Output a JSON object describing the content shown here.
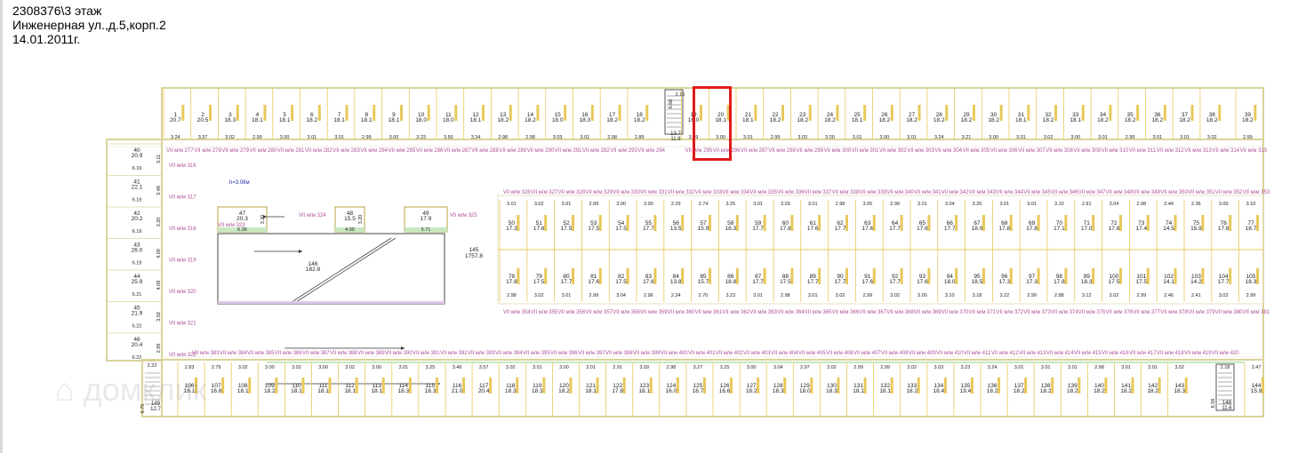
{
  "header": {
    "line1": "2308376\\3 этаж",
    "line2": "Инженерная ул.,д.5,корп.2",
    "line3": "14.01.2011г."
  },
  "colors": {
    "wall": "#d8d49a",
    "divider": "#e8c85a",
    "label_pink": "#b0509a",
    "text": "#222222",
    "highlight": "#e01a1a",
    "interior": "#9aa0c8"
  },
  "watermark": "домклик",
  "plan": {
    "height_note": "h=3.08м",
    "top_row": {
      "ids": [
        "1",
        "2",
        "3",
        "4",
        "5",
        "6",
        "7",
        "8",
        "9",
        "10",
        "11",
        "12",
        "13",
        "14",
        "15",
        "16",
        "17",
        "18",
        "19",
        "20",
        "21",
        "22",
        "23",
        "24",
        "25",
        "26",
        "27",
        "28",
        "29",
        "30",
        "31",
        "32",
        "33",
        "34",
        "35",
        "36",
        "37",
        "38",
        "39"
      ],
      "areas": [
        "20.7",
        "20.5",
        "18.3",
        "18.1",
        "18.1",
        "18.2",
        "18.1",
        "18.1",
        "18.1",
        "18.0",
        "18.0",
        "18.1",
        "18.2",
        "18.2",
        "18.0",
        "18.3",
        "18.2",
        "18.2",
        "16.0",
        "18.1",
        "18.1",
        "18.2",
        "18.2",
        "18.2",
        "18.1",
        "18.2",
        "18.2",
        "18.2",
        "18.2",
        "18.2",
        "18.1",
        "18.2",
        "18.1",
        "18.2",
        "18.2",
        "18.2",
        "18.2",
        "18.2",
        "18.2"
      ],
      "widths": [
        "3.24",
        "3.37",
        "3.02",
        "2.99",
        "3.00",
        "3.01",
        "3.01",
        "2.99",
        "3.00",
        "3.23",
        "3.50",
        "3.34",
        "2.98",
        "2.98",
        "3.03",
        "3.01",
        "2.98",
        "2.89",
        "3.29",
        "3.00",
        "3.01",
        "2.99",
        "3.03",
        "3.00",
        "3.01",
        "3.00",
        "3.01",
        "3.24",
        "3.21",
        "3.00",
        "3.01",
        "3.02",
        "3.00",
        "3.01",
        "2.99",
        "3.01",
        "3.01",
        "3.02",
        "2.99"
      ]
    },
    "corridor_top": [
      "VII м/м 277",
      "VII м/м 278",
      "VII м/м 279",
      "VII м/м 280",
      "VII м/м 281",
      "VII м/м 282",
      "VII м/м 283",
      "VII м/м 284",
      "VII м/м 285",
      "VII м/м 286",
      "VII м/м 287",
      "VII м/м 288",
      "VII м/м 289",
      "VII м/м 290",
      "VII м/м 291",
      "VII м/м 292",
      "VII м/м 293",
      "VII м/м 294",
      "VII м/м 295",
      "VII м/м 296",
      "VII м/м 297",
      "VII м/м 298",
      "VII м/м 299",
      "VII м/м 300",
      "VII м/м 301",
      "VII м/м 302",
      "VII м/м 303",
      "VII м/м 304",
      "VII м/м 305",
      "VII м/м 306",
      "VII м/м 307",
      "VII м/м 308",
      "VII м/м 309",
      "VII м/м 310",
      "VII м/м 311",
      "VII м/м 312",
      "VII м/м 313",
      "VII м/м 314",
      "VII м/м 315"
    ],
    "stair_top": {
      "dim": "2.15",
      "dim2": "6.50",
      "id": "13.7",
      "area": "11.8"
    },
    "left_block": [
      {
        "id": "40",
        "area": "20.9",
        "w": "3.11"
      },
      {
        "id": "41",
        "area": "22.1",
        "w": "3.48"
      },
      {
        "id": "42",
        "area": "20.2",
        "w": "3.20"
      },
      {
        "id": "43",
        "area": "26.0",
        "w": "4.09"
      },
      {
        "id": "44",
        "area": "25.9",
        "w": "4.09"
      },
      {
        "id": "45",
        "area": "21.9",
        "w": "3.59"
      },
      {
        "id": "46",
        "area": "20.4",
        "w": "2.99"
      }
    ],
    "left_dims": [
      "6.19",
      "6.19",
      "6.19",
      "6.19",
      "6.21",
      "6.22",
      "6.22"
    ],
    "left_labels": [
      "VII м/м 316",
      "VII м/м 317",
      "VII м/м 318",
      "VII м/м 319",
      "VII м/м 320",
      "VII м/м 321",
      "VII м/м 322"
    ],
    "hall_spots": [
      {
        "id": "47",
        "area": "20.3",
        "w": "6.36",
        "d": "3.20"
      },
      {
        "id": "48",
        "area": "15.5",
        "w": "4.90",
        "d": "3.20"
      },
      {
        "id": "49",
        "area": "17.9",
        "w": "5.71",
        "d": ""
      }
    ],
    "hall_labels": [
      "VII м/м 323",
      "VII м/м 324",
      "VII м/м 325"
    ],
    "ramp": {
      "id": "146",
      "area": "182.8"
    },
    "zone": {
      "id": "145",
      "area": "1757.8"
    },
    "mid_top_labels": [
      "VII м/м 326",
      "VII м/м 327",
      "VII м/м 328",
      "VII м/м 329",
      "VII м/м 330",
      "VII м/м 331",
      "VII м/м 332",
      "VII м/м 333",
      "VII м/м 334",
      "VII м/м 335",
      "VII м/м 336",
      "VII м/м 337",
      "VII м/м 338",
      "VII м/м 339",
      "VII м/м 340",
      "VII м/м 341",
      "VII м/м 342",
      "VII м/м 343",
      "VII м/м 344",
      "VII м/м 345",
      "VII м/м 346",
      "VII м/м 347",
      "VII м/м 348",
      "VII м/м 349",
      "VII м/м 350",
      "VII м/м 351",
      "VII м/м 352",
      "VII м/м 353"
    ],
    "mid_row_a": {
      "ids": [
        "50",
        "51",
        "52",
        "53",
        "54",
        "55",
        "56",
        "57",
        "58",
        "59",
        "60",
        "61",
        "62",
        "63",
        "64",
        "65",
        "66",
        "67",
        "68",
        "69",
        "70",
        "71",
        "72",
        "73",
        "74",
        "75",
        "76",
        "77"
      ],
      "areas": [
        "17.3",
        "17.6",
        "17.5",
        "17.5",
        "17.5",
        "17.7",
        "13.5",
        "15.9",
        "18.3",
        "17.7",
        "17.8",
        "17.6",
        "17.7",
        "17.6",
        "17.7",
        "17.6",
        "17.7",
        "18.9",
        "17.8",
        "17.8",
        "17.1",
        "17.0",
        "17.8",
        "17.4",
        "14.5",
        "15.9",
        "17.6",
        "18.7"
      ],
      "widths": [
        "3.01",
        "3.02",
        "3.01",
        "2.99",
        "3.00",
        "3.00",
        "2.29",
        "2.74",
        "3.25",
        "3.01",
        "3.03",
        "3.01",
        "2.98",
        "3.05",
        "2.99",
        "3.01",
        "3.04",
        "3.20",
        "3.01",
        "3.01",
        "3.10",
        "2.91",
        "3.04",
        "2.98",
        "2.44",
        "2.36",
        "3.00",
        "3.10"
      ]
    },
    "mid_row_b": {
      "ids": [
        "78",
        "79",
        "80",
        "81",
        "82",
        "83",
        "84",
        "85",
        "86",
        "87",
        "88",
        "89",
        "90",
        "91",
        "92",
        "93",
        "94",
        "95",
        "96",
        "97",
        "98",
        "99",
        "100",
        "101",
        "102",
        "103",
        "104",
        "105"
      ],
      "areas": [
        "17.8",
        "17.5",
        "17.7",
        "17.6",
        "17.5",
        "17.6",
        "13.8",
        "15.7",
        "18.8",
        "17.7",
        "17.5",
        "17.7",
        "17.7",
        "17.6",
        "17.7",
        "17.6",
        "18.0",
        "18.5",
        "17.3",
        "17.3",
        "17.8",
        "18.3",
        "17.5",
        "17.5",
        "14.1",
        "14.2",
        "17.7",
        "18.3"
      ],
      "widths": [
        "2.98",
        "3.02",
        "3.01",
        "2.99",
        "3.04",
        "2.96",
        "2.34",
        "2.70",
        "3.23",
        "3.01",
        "2.98",
        "3.01",
        "3.02",
        "2.99",
        "3.02",
        "3.00",
        "3.10",
        "3.18",
        "3.22",
        "2.99",
        "2.88",
        "3.12",
        "3.02",
        "2.99",
        "2.46",
        "2.41",
        "3.02",
        "2.99"
      ]
    },
    "mid_bottom_labels": [
      "VII м/м 354",
      "VII м/м 355",
      "VII м/м 356",
      "VII м/м 357",
      "VII м/м 358",
      "VII м/м 359",
      "VII м/м 360",
      "VII м/м 361",
      "VII м/м 362",
      "VII м/м 363",
      "VII м/м 364",
      "VII м/м 365",
      "VII м/м 366",
      "VII м/м 367",
      "VII м/м 368",
      "VII м/м 369",
      "VII м/м 370",
      "VII м/м 371",
      "VII м/м 372",
      "VII м/м 373",
      "VII м/м 374",
      "VII м/м 375",
      "VII м/м 376",
      "VII м/м 377",
      "VII м/м 378",
      "VII м/м 379",
      "VII м/м 380",
      "VII м/м 381"
    ],
    "corridor_bottom": [
      "VII м/м 383",
      "VII м/м 384",
      "VII м/м 385",
      "VII м/м 386",
      "VII м/м 387",
      "VII м/м 388",
      "VII м/м 389",
      "VII м/м 390",
      "VII м/м 391",
      "VII м/м 392",
      "VII м/м 393",
      "VII м/м 394",
      "VII м/м 395",
      "VII м/м 396",
      "VII м/м 397",
      "VII м/м 398",
      "VII м/м 399",
      "VII м/м 400",
      "VII м/м 401",
      "VII м/м 402",
      "VII м/м 403",
      "VII м/м 404",
      "VII м/м 405",
      "VII м/м 406",
      "VII м/м 407",
      "VII м/м 408",
      "VII м/м 409",
      "VII м/м 410",
      "VII м/м 411",
      "VII м/м 412",
      "VII м/м 413",
      "VII м/м 414",
      "VII м/м 415",
      "VII м/м 416",
      "VII м/м 417",
      "VII м/м 418",
      "VII м/м 419",
      "VII м/м 420"
    ],
    "bottom_row": {
      "ids": [
        "106",
        "107",
        "108",
        "109",
        "110",
        "111",
        "112",
        "113",
        "114",
        "115",
        "116",
        "117",
        "118",
        "119",
        "120",
        "121",
        "122",
        "123",
        "124",
        "125",
        "126",
        "127",
        "128",
        "129",
        "130",
        "131",
        "132",
        "133",
        "134",
        "135",
        "136",
        "137",
        "138",
        "139",
        "140",
        "141",
        "142",
        "143",
        "144"
      ],
      "areas": [
        "16.1",
        "16.8",
        "18.1",
        "18.2",
        "18.1",
        "18.1",
        "18.1",
        "18.1",
        "18.3",
        "18.3",
        "21.0",
        "20.4",
        "18.3",
        "18.3",
        "18.2",
        "18.1",
        "17.8",
        "18.1",
        "16.0",
        "16.7",
        "16.6",
        "18.2",
        "18.3",
        "18.0",
        "18.3",
        "18.1",
        "18.1",
        "18.2",
        "18.4",
        "19.4",
        "18.2",
        "18.2",
        "18.2",
        "18.2",
        "18.2",
        "18.2",
        "18.2",
        "18.3",
        "15.9"
      ],
      "widths": [
        "2.83",
        "2.79",
        "3.02",
        "3.00",
        "3.02",
        "3.00",
        "3.02",
        "3.00",
        "3.01",
        "3.25",
        "3.46",
        "3.57",
        "3.02",
        "3.01",
        "3.00",
        "3.01",
        "2.91",
        "3.09",
        "2.98",
        "3.27",
        "3.25",
        "3.00",
        "3.04",
        "2.97",
        "3.02",
        "2.99",
        "2.99",
        "3.02",
        "3.03",
        "3.23",
        "3.24",
        "3.01",
        "3.01",
        "3.01",
        "2.98",
        "3.01",
        "3.01",
        "3.02",
        "2.47"
      ]
    },
    "stair_bl": {
      "dim": "2.22",
      "id": "149",
      "area": "12.7",
      "dim2": "6.75"
    },
    "stair_br": {
      "dim": "2.18",
      "dim2": "6.56",
      "id": "148",
      "area": "11.6"
    }
  }
}
